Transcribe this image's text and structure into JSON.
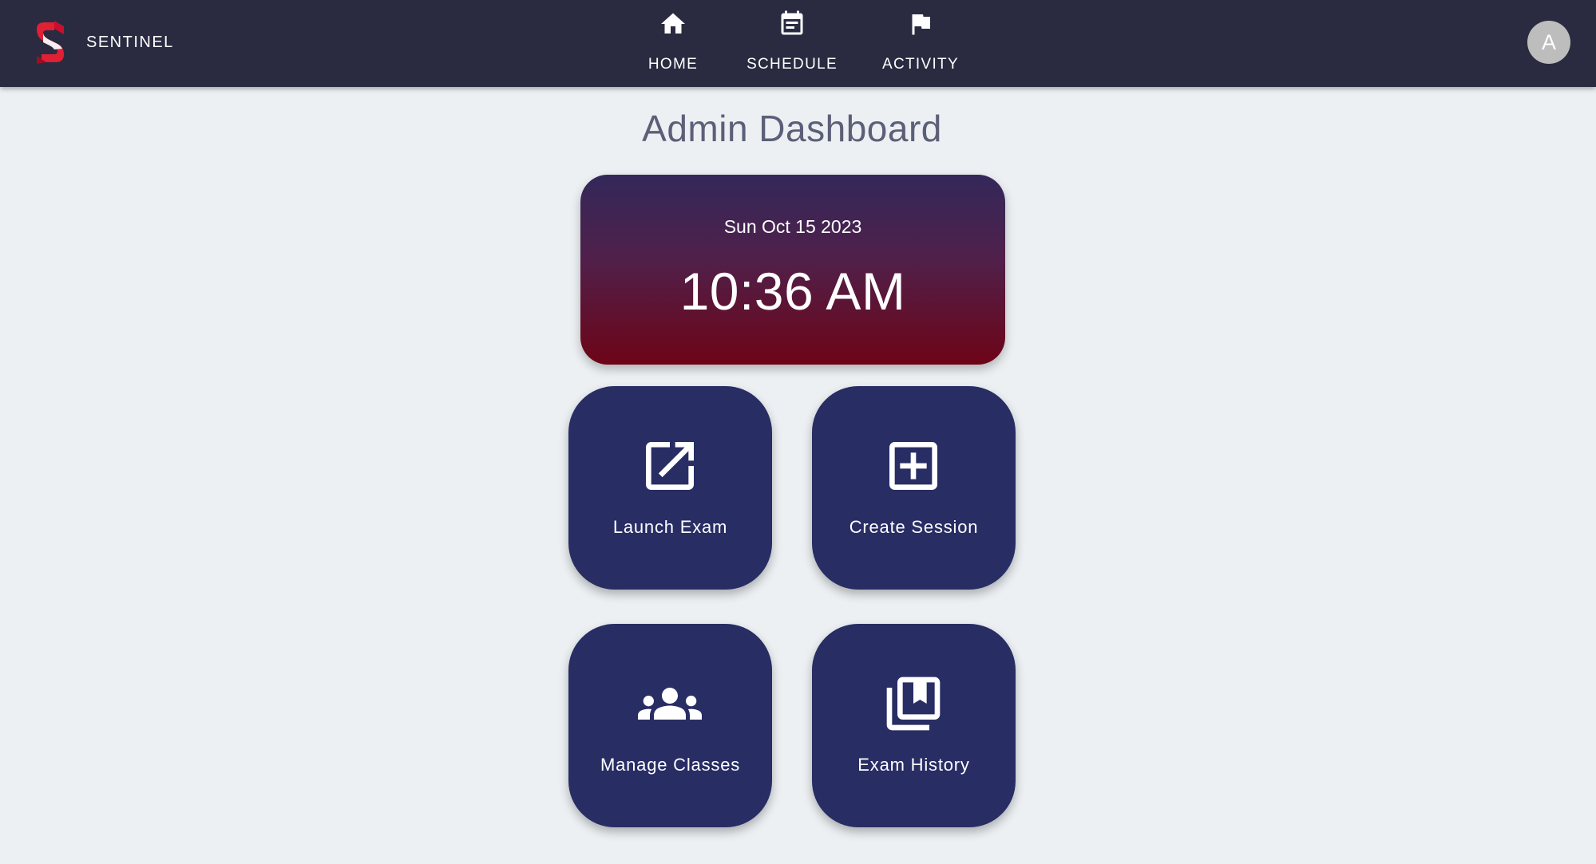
{
  "app": {
    "name": "SENTINEL",
    "logo_icon": "sentinel-s-logo"
  },
  "nav": {
    "items": [
      {
        "label": "HOME",
        "icon": "home-icon"
      },
      {
        "label": "SCHEDULE",
        "icon": "calendar-icon"
      },
      {
        "label": "ACTIVITY",
        "icon": "flag-icon"
      }
    ]
  },
  "user": {
    "avatar_initial": "A"
  },
  "page": {
    "title": "Admin Dashboard"
  },
  "clock": {
    "date": "Sun Oct 15 2023",
    "time": "10:36 AM"
  },
  "tiles": [
    {
      "label": "Launch Exam",
      "icon": "open-in-new-icon"
    },
    {
      "label": "Create Session",
      "icon": "add-box-icon"
    },
    {
      "label": "Manage Classes",
      "icon": "groups-icon"
    },
    {
      "label": "Exam History",
      "icon": "library-books-icon"
    }
  ],
  "colors": {
    "navbar": "#2a2b40",
    "background": "#ecf0f3",
    "tile": "#282d64",
    "clock_gradient_top": "#33285a",
    "clock_gradient_bottom": "#6e0417",
    "logo_red": "#e02035",
    "avatar": "#bdbdbd"
  }
}
